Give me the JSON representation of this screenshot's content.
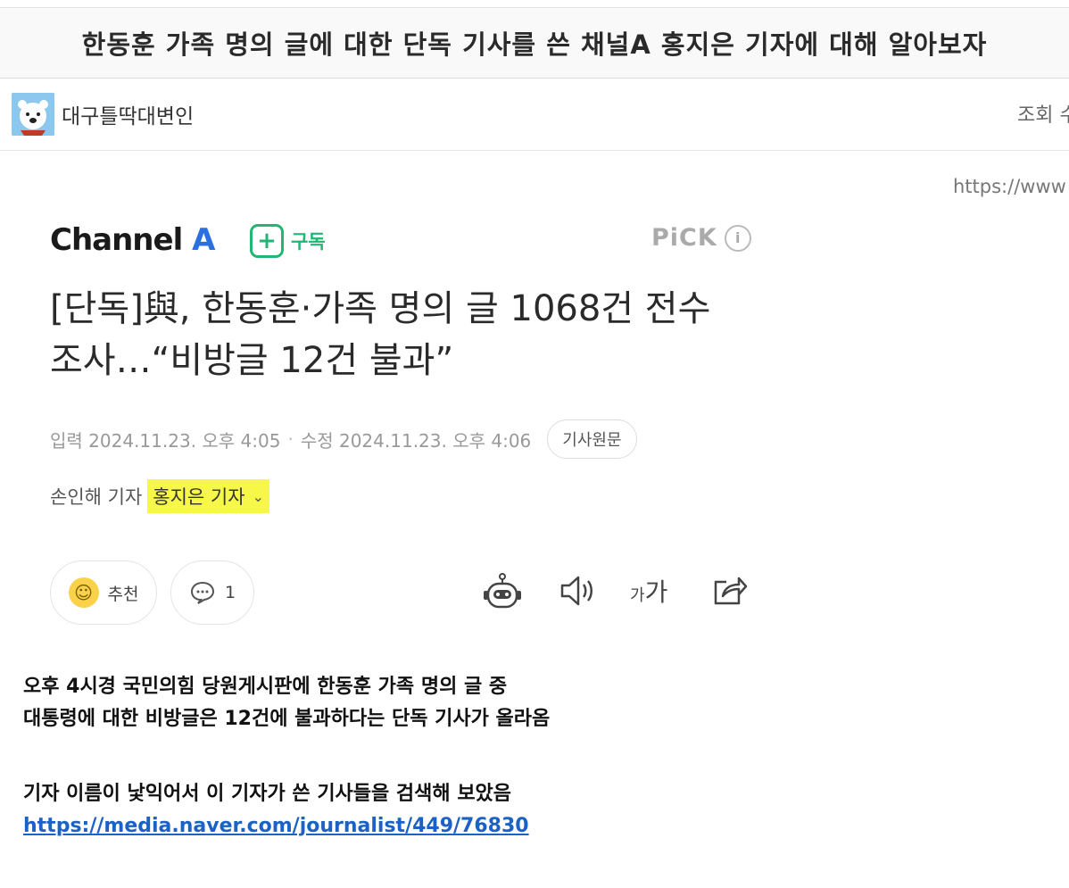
{
  "post": {
    "title": "한동훈 가족 명의 글에 대한 단독 기사를 쓴 채널A 홍지은 기자에 대해 알아보자",
    "author": "대구틀딱대변인",
    "views_label": "조회 수",
    "source_url": "https://www"
  },
  "article": {
    "channel_name": "Channel",
    "channel_letter": "A",
    "subscribe_label": "구독",
    "pick_label": "PiCK",
    "info_symbol": "i",
    "headline_line1": "[단독]與, 한동훈·가족 명의 글 1068건 전수",
    "headline_line2": "조사…“비방글 12건 불과”",
    "input_time": "입력 2024.11.23. 오후 4:05",
    "edit_time": "수정 2024.11.23. 오후 4:06",
    "original_button": "기사원문",
    "reporter_1": "손인해 기자",
    "reporter_2": "홍지은 기자",
    "recommend_label": "추천",
    "comment_count": "1",
    "font_size_small": "가",
    "font_size_large": "가"
  },
  "body": {
    "line1": "오후 4시경 국민의힘 당원게시판에 한동훈 가족 명의 글 중",
    "line2": "대통령에 대한 비방글은 12건에 불과하다는 단독 기사가 올라옴",
    "line3": "기자 이름이 낯익어서 이 기자가 쓴 기사들을 검색해 보았음",
    "link": "https://media.naver.com/journalist/449/76830"
  },
  "colors": {
    "subscribe_green": "#22b573",
    "channel_blue": "#2c6fe0",
    "highlight_yellow": "#f7f74a",
    "link_blue": "#1a62c6"
  }
}
